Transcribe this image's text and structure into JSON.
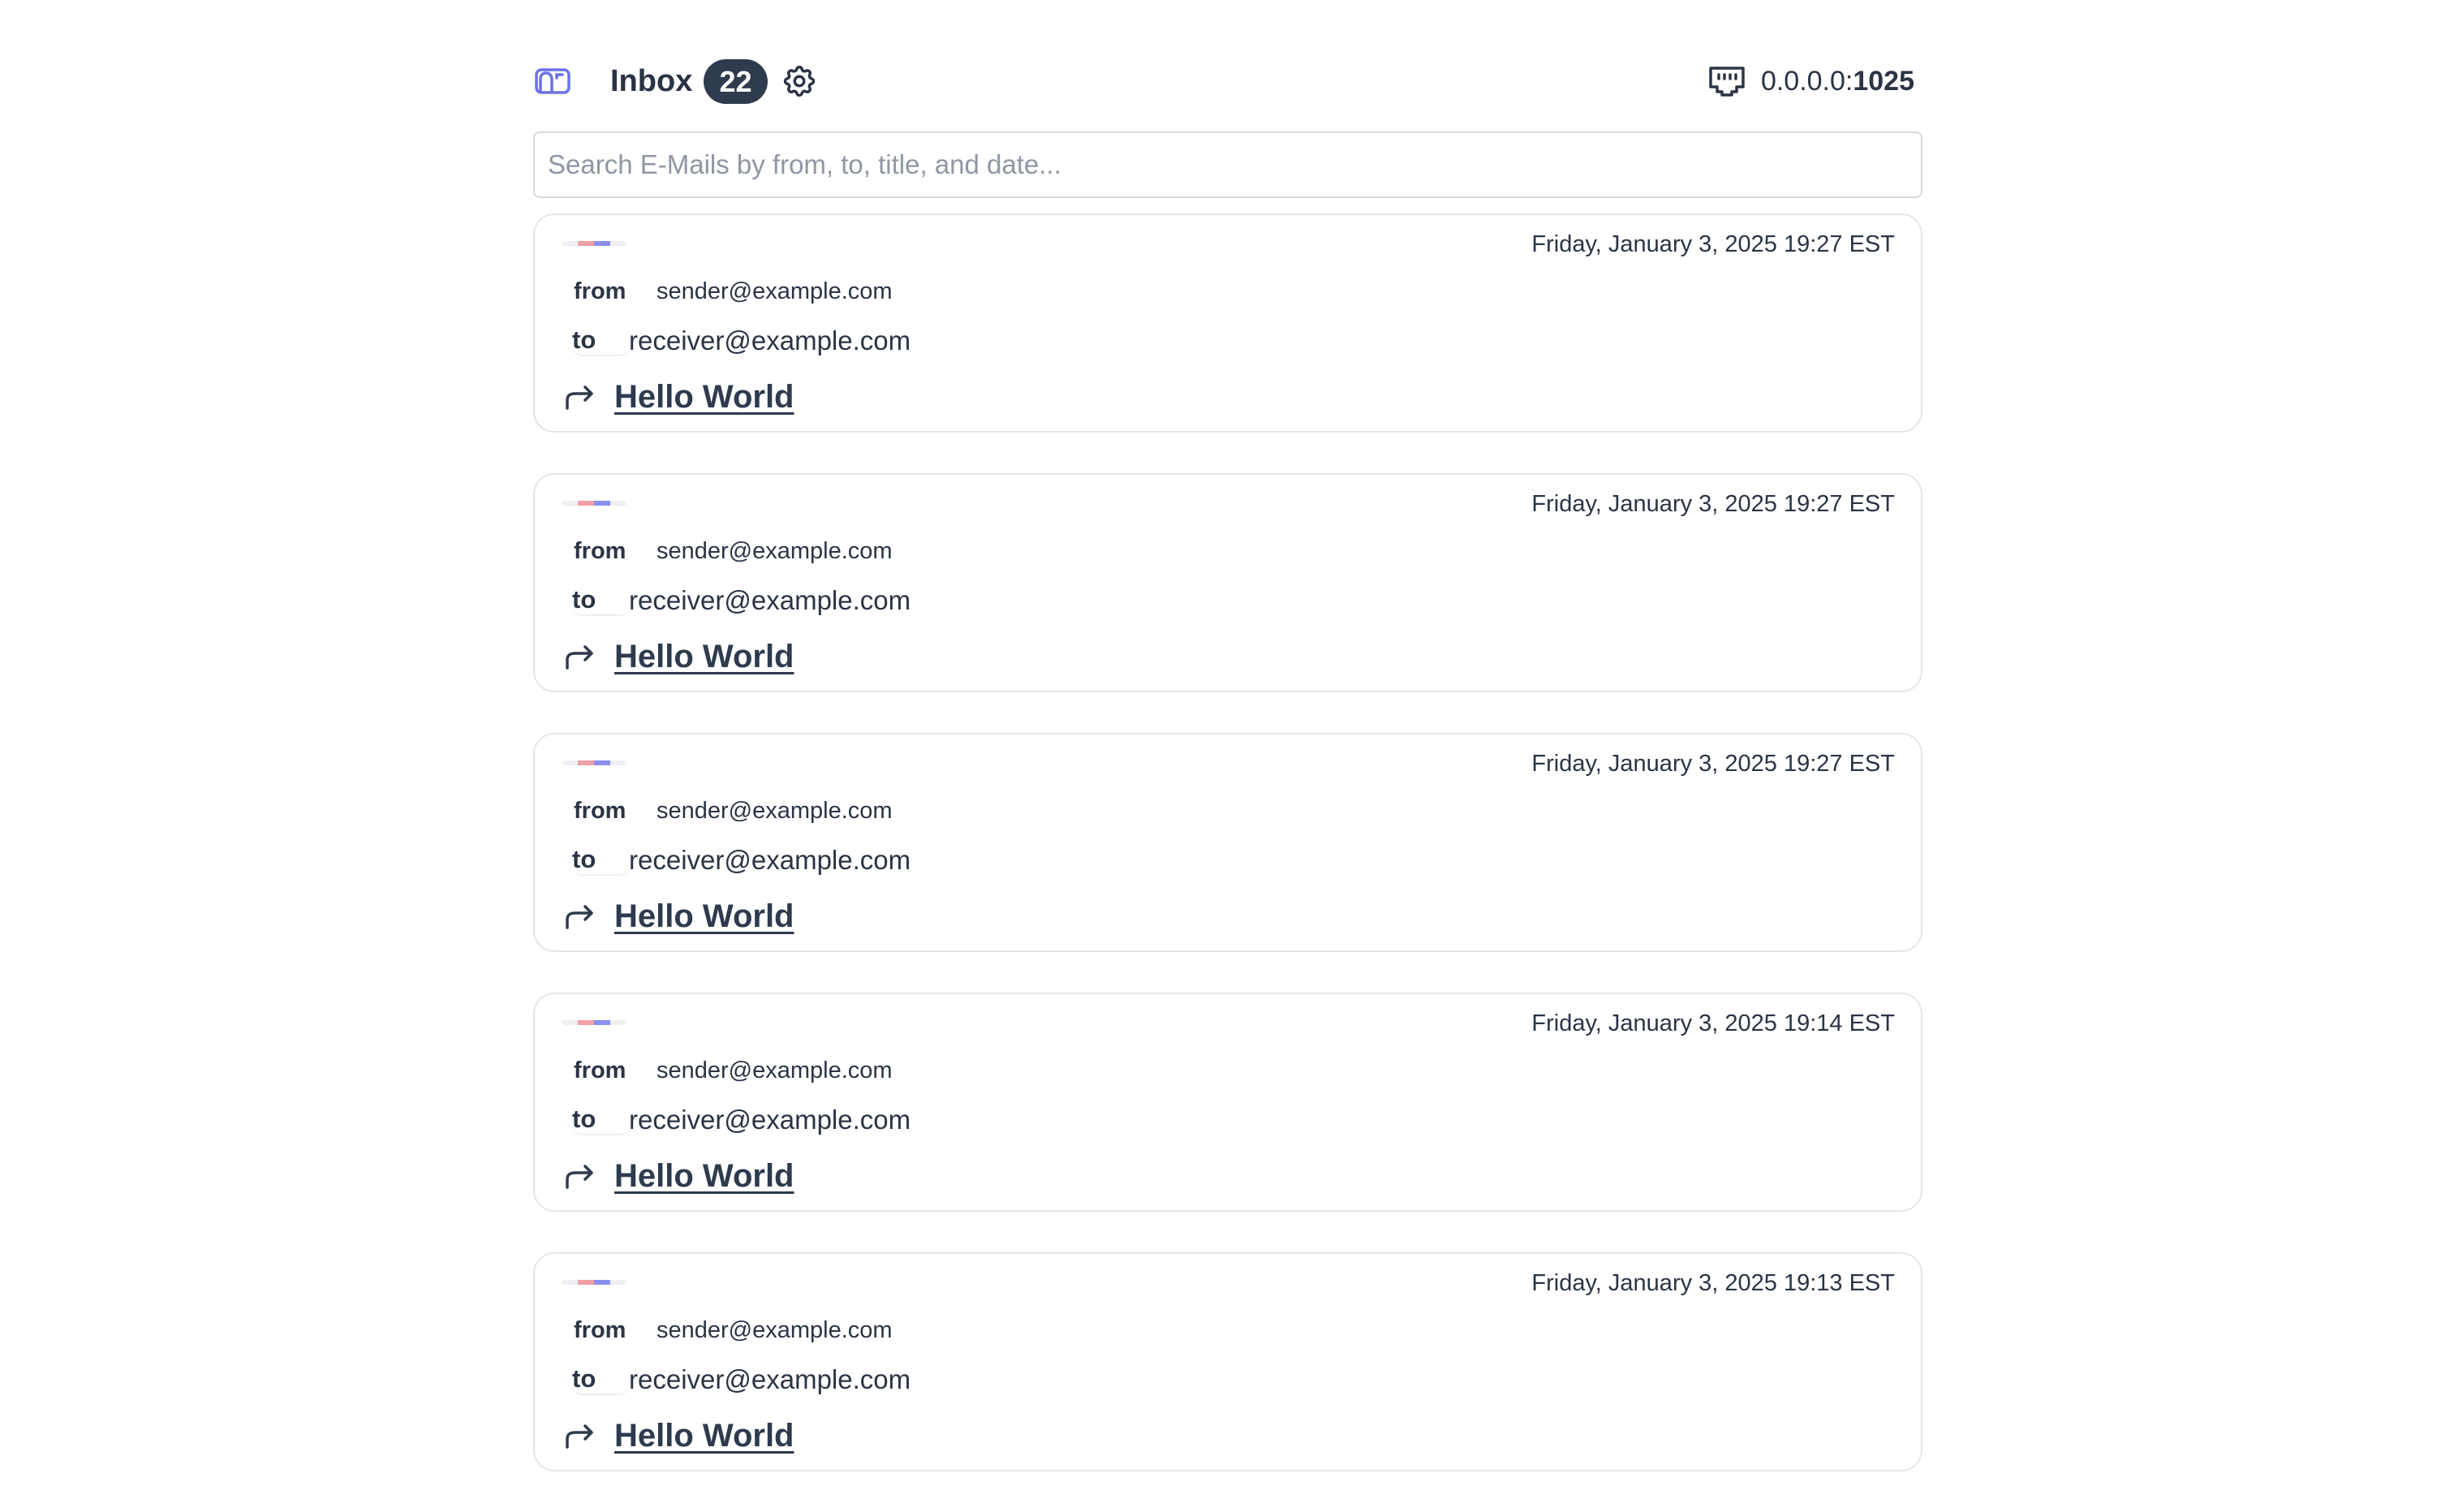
{
  "header": {
    "logo_icon": "mailbox-icon",
    "title": "Inbox",
    "unread_count": "22",
    "settings_icon": "gear-icon",
    "server": {
      "icon": "ethernet-port-icon",
      "host": "0.0.0.0:",
      "port": "1025"
    }
  },
  "search": {
    "placeholder": "Search E-Mails by from, to, title, and date...",
    "value": ""
  },
  "colors": {
    "text": "#2e3a4d",
    "badge_bg": "#2f3b4e",
    "accent_blue": "#6c73e6",
    "tag_pink": "#f1a0a6",
    "tag_purple": "#8a8ff2",
    "border": "#e3e6ea"
  },
  "emails": [
    {
      "date": "Friday, January 3, 2025 19:27 EST",
      "from_label": "from",
      "from": "sender@example.com",
      "to_label": "to",
      "to": "receiver@example.com",
      "subject_icon": "reply-arrow-icon",
      "subject": "Hello World"
    },
    {
      "date": "Friday, January 3, 2025 19:27 EST",
      "from_label": "from",
      "from": "sender@example.com",
      "to_label": "to",
      "to": "receiver@example.com",
      "subject_icon": "reply-arrow-icon",
      "subject": "Hello World"
    },
    {
      "date": "Friday, January 3, 2025 19:27 EST",
      "from_label": "from",
      "from": "sender@example.com",
      "to_label": "to",
      "to": "receiver@example.com",
      "subject_icon": "reply-arrow-icon",
      "subject": "Hello World"
    },
    {
      "date": "Friday, January 3, 2025 19:14 EST",
      "from_label": "from",
      "from": "sender@example.com",
      "to_label": "to",
      "to": "receiver@example.com",
      "subject_icon": "reply-arrow-icon",
      "subject": "Hello World"
    },
    {
      "date": "Friday, January 3, 2025 19:13 EST",
      "from_label": "from",
      "from": "sender@example.com",
      "to_label": "to",
      "to": "receiver@example.com",
      "subject_icon": "reply-arrow-icon",
      "subject": "Hello World"
    }
  ]
}
